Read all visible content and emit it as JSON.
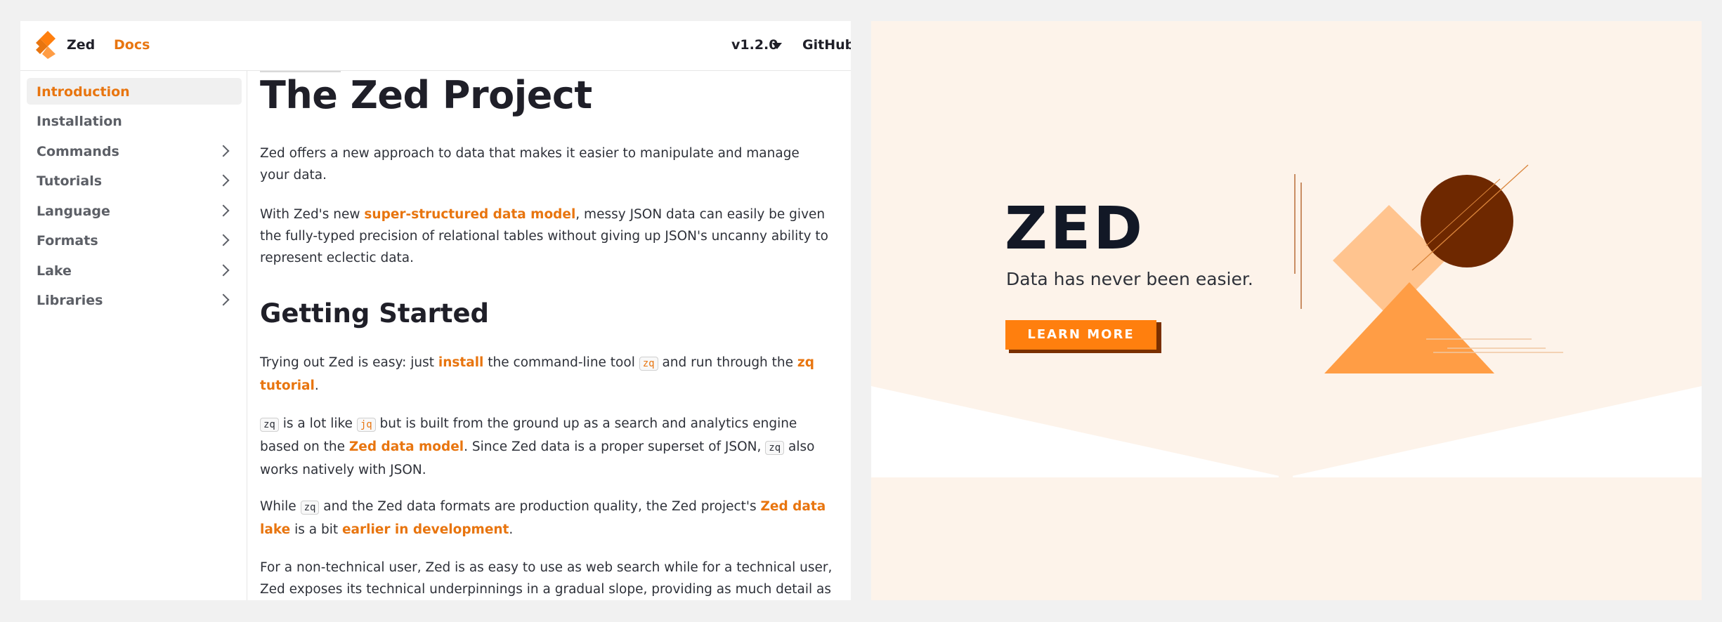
{
  "header": {
    "brand": "Zed",
    "docs_link": "Docs",
    "version": "v1.2.0",
    "github_label": "GitHub"
  },
  "sidebar": {
    "items": [
      {
        "label": "Introduction",
        "active": true,
        "expandable": false
      },
      {
        "label": "Installation",
        "active": false,
        "expandable": false
      },
      {
        "label": "Commands",
        "active": false,
        "expandable": true
      },
      {
        "label": "Tutorials",
        "active": false,
        "expandable": true
      },
      {
        "label": "Language",
        "active": false,
        "expandable": true
      },
      {
        "label": "Formats",
        "active": false,
        "expandable": true
      },
      {
        "label": "Lake",
        "active": false,
        "expandable": true
      },
      {
        "label": "Libraries",
        "active": false,
        "expandable": true
      }
    ]
  },
  "content": {
    "title": "The Zed Project",
    "intro": "Zed offers a new approach to data that makes it easier to manipulate and manage your data.",
    "p2": {
      "before": "With Zed's new ",
      "link": "super-structured data model",
      "after": ", messy JSON data can easily be given the fully-typed precision of relational tables without giving up JSON's uncanny ability to represent eclectic data."
    },
    "heading_getting_started": "Getting Started",
    "p3": {
      "t1": "Trying out Zed is easy: just ",
      "link_install": "install",
      "t2": " the command-line tool ",
      "code_zq": "zq",
      "t3": " and run through the ",
      "link_tutorial": "zq tutorial",
      "t4": "."
    },
    "p4": {
      "code_zq": "zq",
      "t1": " is a lot like ",
      "code_jq": "jq",
      "t2": " but is built from the ground up as a search and analytics engine based on the ",
      "link_model": "Zed data model",
      "t3": ". Since Zed data is a proper superset of JSON, ",
      "code_zq2": "zq",
      "t4": " also works natively with JSON."
    },
    "p5": {
      "t1": "While ",
      "code_zq": "zq",
      "t2": " and the Zed data formats are production quality, the Zed project's ",
      "link_lake": "Zed data lake",
      "t3": " is a bit ",
      "link_dev": "earlier in development",
      "t4": "."
    },
    "p6": "For a non-technical user, Zed is as easy to use as web search while for a technical user, Zed exposes its technical underpinnings in a gradual slope, providing as much detail as desired,"
  },
  "promo": {
    "title": "ZED",
    "subtitle": "Data has never been easier.",
    "button": "LEARN MORE"
  },
  "icons": {
    "logo": "zed-logo-icon",
    "version_caret": "caret-down-icon",
    "sidebar_chevron": "chevron-right-icon"
  },
  "colors": {
    "accent": "#e8750f",
    "button": "#ff7f0e",
    "button_shadow": "#7a2f00",
    "promo_bg": "#fdf3ea",
    "circle": "#6e2800",
    "diamond": "#ffc48f",
    "triangle": "#ff9d45"
  }
}
